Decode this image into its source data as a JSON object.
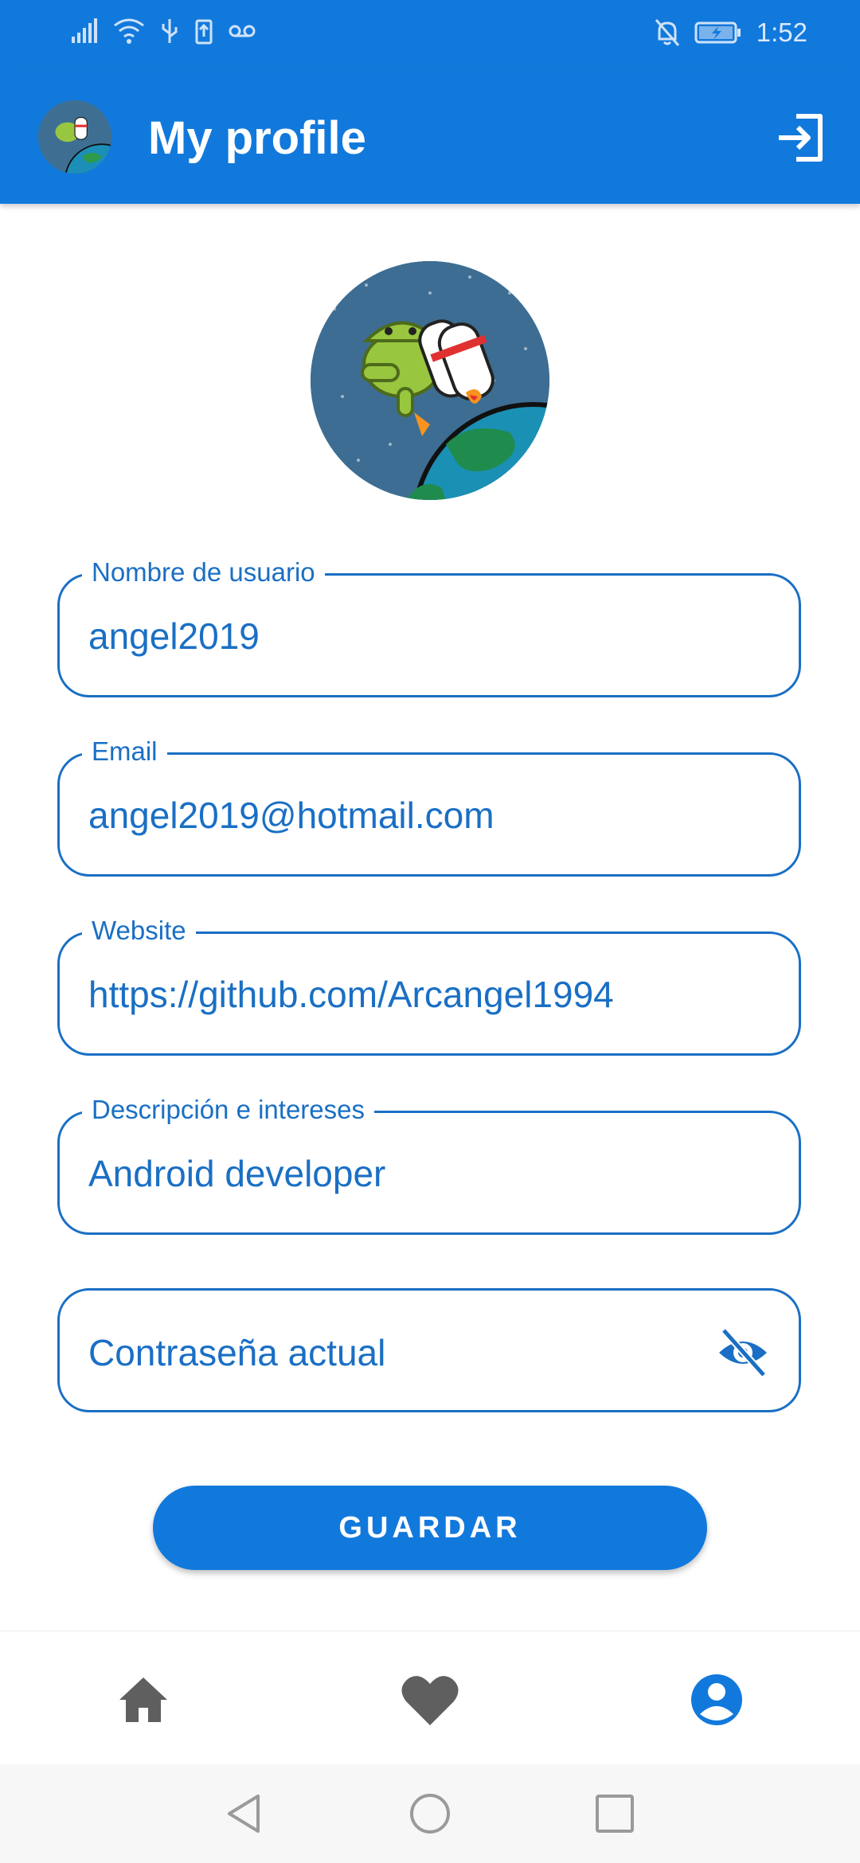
{
  "status_bar": {
    "time": "1:52",
    "left_icons": [
      "signal-icon",
      "wifi-icon",
      "usb-icon",
      "battery-saver-icon",
      "voicemail-icon"
    ],
    "right_icons": [
      "notifications-off-icon",
      "battery-charging-icon"
    ]
  },
  "app_bar": {
    "title": "My profile",
    "logout_icon": "logout-icon"
  },
  "form": {
    "username": {
      "label": "Nombre de usuario",
      "value": "angel2019"
    },
    "email": {
      "label": "Email",
      "value": "angel2019@hotmail.com"
    },
    "website": {
      "label": "Website",
      "value": "https://github.com/Arcangel1994"
    },
    "description": {
      "label": "Descripción e intereses",
      "value": "Android developer"
    },
    "password": {
      "placeholder": "Contraseña actual",
      "toggle_icon": "visibility-off-icon"
    }
  },
  "save_button": {
    "label": "GUARDAR"
  },
  "bottom_nav": {
    "items": [
      {
        "icon": "home-icon",
        "selected": false
      },
      {
        "icon": "heart-icon",
        "selected": false
      },
      {
        "icon": "account-icon",
        "selected": true
      }
    ]
  },
  "colors": {
    "primary": "#1279dc",
    "field_accent": "#1a6fc4",
    "nav_inactive": "#5f5f5f"
  }
}
